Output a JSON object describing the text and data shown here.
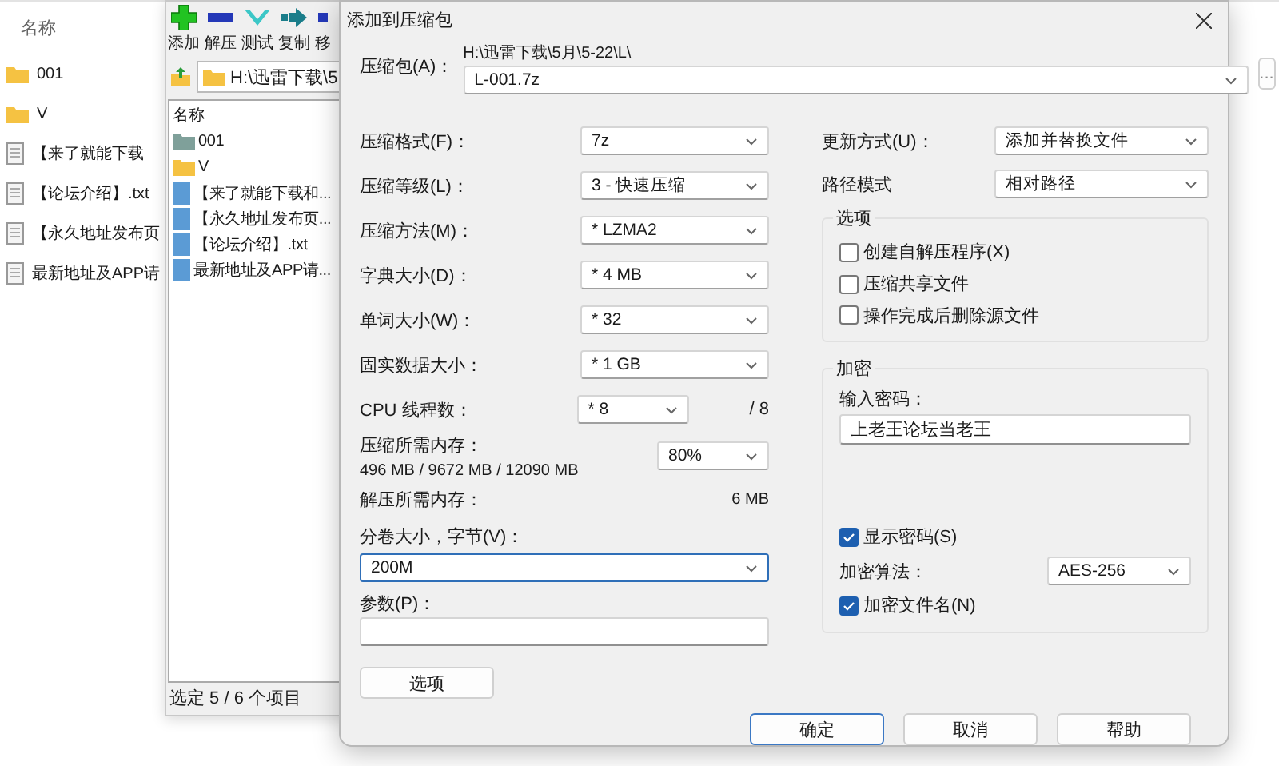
{
  "explorer": {
    "column": "名称",
    "items": [
      {
        "kind": "folder",
        "name": "001"
      },
      {
        "kind": "folder",
        "name": "V"
      },
      {
        "kind": "file",
        "name": "【来了就能下载"
      },
      {
        "kind": "file",
        "name": "【论坛介绍】.txt"
      },
      {
        "kind": "file",
        "name": "【永久地址发布页"
      },
      {
        "kind": "file",
        "name": "最新地址及APP请"
      }
    ]
  },
  "archiver": {
    "toolbar": [
      {
        "kind": "add",
        "label": "添加"
      },
      {
        "kind": "extract",
        "label": "解压"
      },
      {
        "kind": "test",
        "label": "测试"
      },
      {
        "kind": "copy",
        "label": "复制"
      },
      {
        "kind": "move",
        "label": "移"
      }
    ],
    "path": "H:\\迅雷下载\\5",
    "column": "名称",
    "items": [
      {
        "kind": "archive-folder",
        "name": "001"
      },
      {
        "kind": "folder",
        "name": "V"
      },
      {
        "kind": "file",
        "name": "【来了就能下载和..."
      },
      {
        "kind": "file",
        "name": "【永久地址发布页..."
      },
      {
        "kind": "file",
        "name": "【论坛介绍】.txt"
      },
      {
        "kind": "file",
        "name": "最新地址及APP请..."
      }
    ],
    "status": "选定 5 / 6 个项目"
  },
  "dialog": {
    "title": "添加到压缩包",
    "archive": {
      "label": "压缩包(A)：",
      "folder": "H:\\迅雷下载\\5月\\5-22\\L\\",
      "value": "L-001.7z",
      "browse": "..."
    },
    "settings": [
      {
        "label": "压缩格式(F)：",
        "value": "7z"
      },
      {
        "label": "压缩等级(L)：",
        "value": "3 - 快速压缩"
      },
      {
        "label": "压缩方法(M)：",
        "value": "* LZMA2"
      },
      {
        "label": "字典大小(D)：",
        "value": "* 4 MB"
      },
      {
        "label": "单词大小(W)：",
        "value": "* 32"
      },
      {
        "label": "固实数据大小：",
        "value": "* 1 GB"
      }
    ],
    "cpu": {
      "label": "CPU 线程数：",
      "value": "* 8",
      "suffix": "/ 8"
    },
    "memory": {
      "label": "压缩所需内存：",
      "detail": "496 MB / 9672 MB / 12090 MB",
      "value": "80%"
    },
    "decompress": {
      "label": "解压所需内存：",
      "value": "6 MB"
    },
    "volume": {
      "label": "分卷大小，字节(V)：",
      "value": "200M"
    },
    "params": {
      "label": "参数(P)："
    },
    "options_button": "选项",
    "update": {
      "label": "更新方式(U)：",
      "value": "添加并替换文件"
    },
    "path_mode": {
      "label": "路径模式",
      "value": "相对路径"
    },
    "options": {
      "title": "选项",
      "items": [
        {
          "label": "创建自解压程序(X)",
          "checked": false
        },
        {
          "label": "压缩共享文件",
          "checked": false
        },
        {
          "label": "操作完成后删除源文件",
          "checked": false
        }
      ]
    },
    "encryption": {
      "title": "加密",
      "password_label": "输入密码：",
      "password": "上老王论坛当老王",
      "show_password": {
        "label": "显示密码(S)",
        "checked": true
      },
      "method": {
        "label": "加密算法：",
        "value": "AES-256"
      },
      "encrypt_names": {
        "label": "加密文件名(N)",
        "checked": true
      }
    },
    "buttons": [
      {
        "label": "确定",
        "default": true
      },
      {
        "label": "取消",
        "default": false
      },
      {
        "label": "帮助",
        "default": false
      }
    ]
  }
}
